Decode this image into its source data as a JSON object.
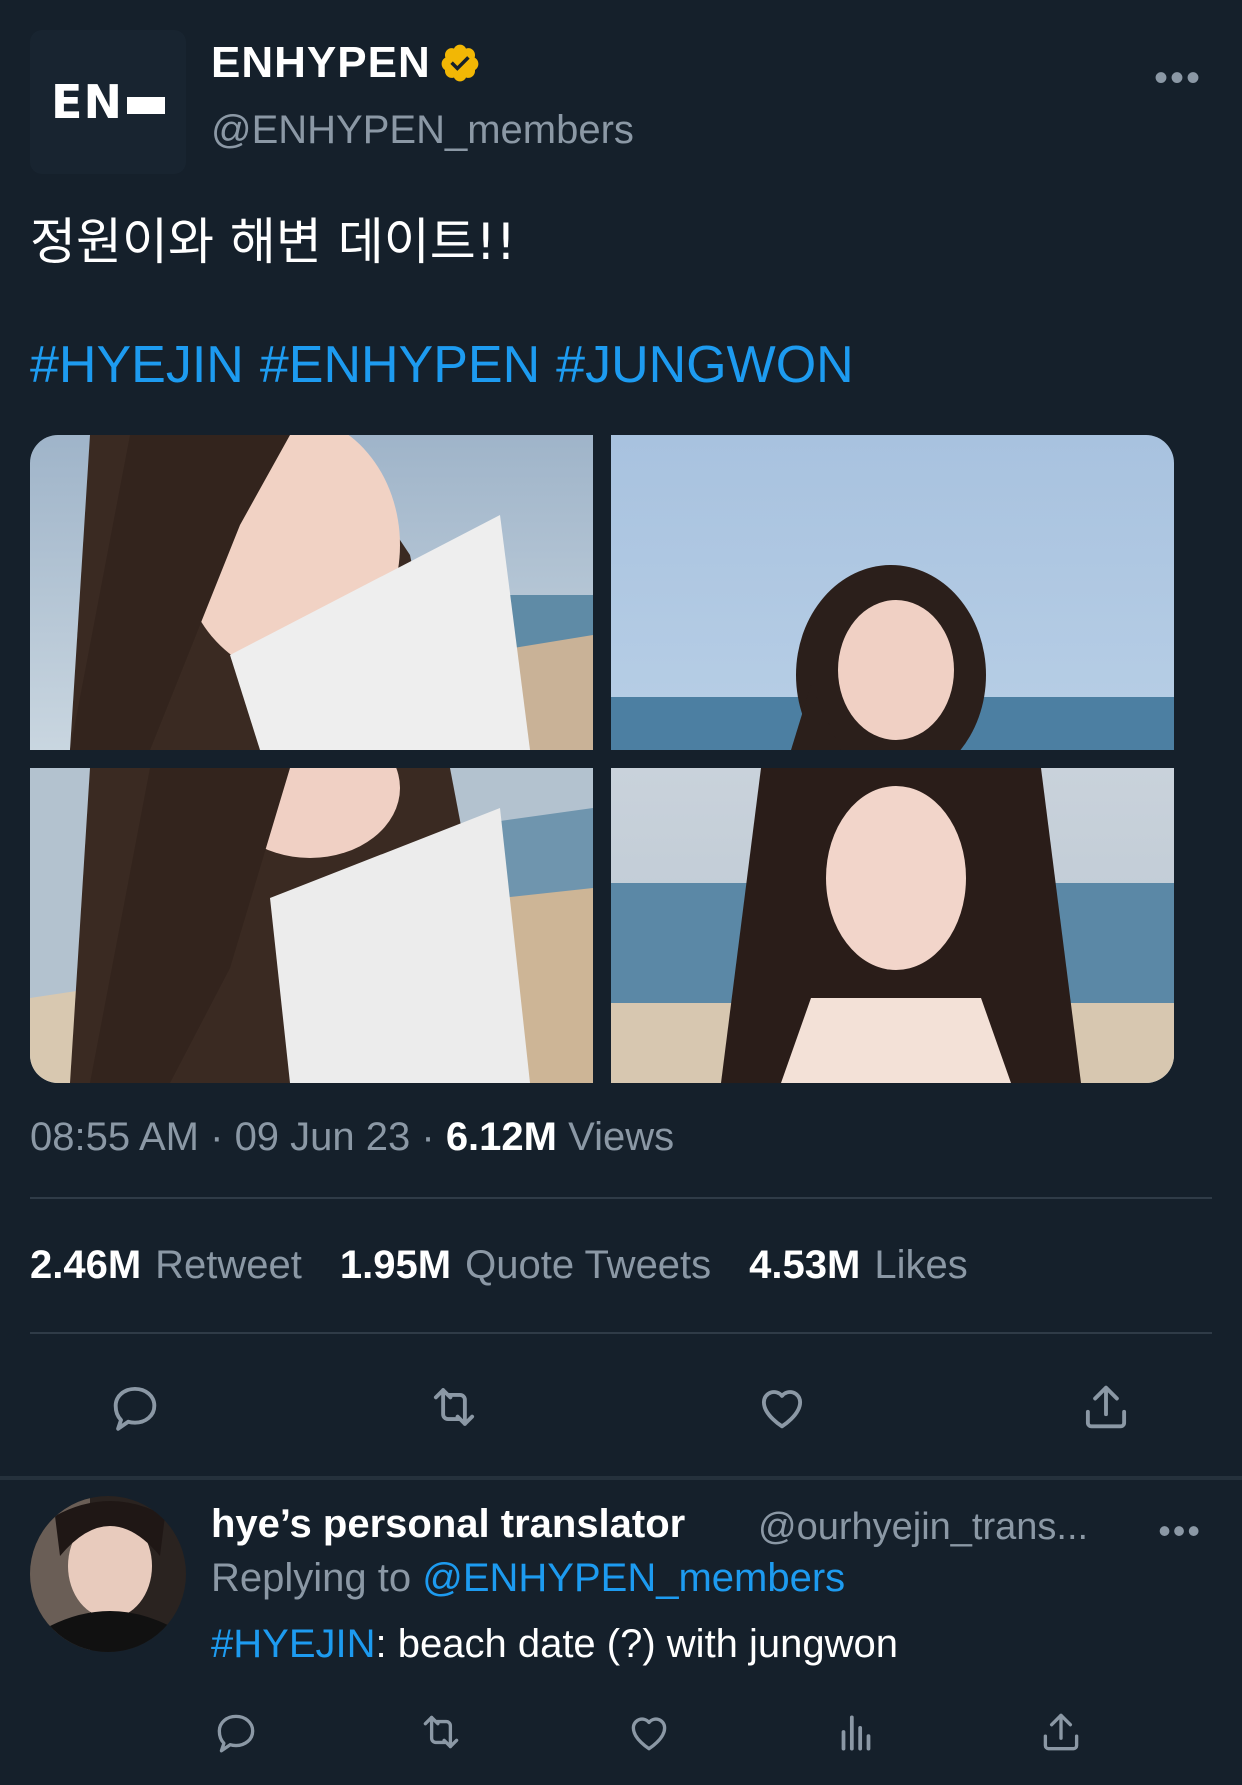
{
  "author": {
    "logo_text": "EN",
    "display_name": "ENHYPEN",
    "handle": "@ENHYPEN_members",
    "more_icon": "more-horizontal-icon",
    "verified_color": "#f2b705"
  },
  "tweet": {
    "text": "정원이와 해변 데이트!!",
    "hashtags": [
      "#HYEJIN",
      "#ENHYPEN",
      "#JUNGWON"
    ],
    "time": "08:55 AM",
    "date": "09 Jun 23",
    "views_count": "6.12M",
    "views_label": "Views",
    "photo_count": 4
  },
  "stats": {
    "retweets_count": "2.46M",
    "retweets_label": "Retweet",
    "quotes_count": "1.95M",
    "quotes_label": "Quote Tweets",
    "likes_count": "4.53M",
    "likes_label": "Likes"
  },
  "actions": [
    "reply-icon",
    "retweet-icon",
    "like-icon",
    "share-icon"
  ],
  "reply": {
    "display_name": "hye’s personal translator",
    "handle": "@ourhyejin_trans...",
    "replying_prefix": "Replying to",
    "replying_to": "@ENHYPEN_members",
    "hashtag": "#HYEJIN",
    "text": ": beach date (?) with jungwon",
    "actions": [
      "reply-icon",
      "retweet-icon",
      "like-icon",
      "analytics-icon",
      "share-icon"
    ]
  },
  "colors": {
    "background": "#15202b",
    "accent": "#1d9bf0",
    "muted": "#8b98a5"
  }
}
